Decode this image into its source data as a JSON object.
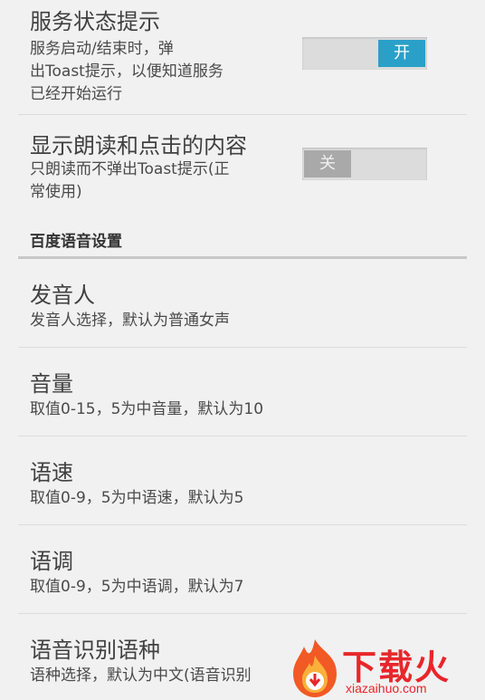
{
  "prefs": {
    "service_status": {
      "title": "服务状态提示",
      "summary_line1": "服务启动/结束时，弹",
      "summary_line2": "出Toast提示，以便知道服务",
      "summary_line3": "已经开始运行",
      "toggle_label": "开",
      "toggle_state": "on"
    },
    "show_content": {
      "title": "显示朗读和点击的内容",
      "summary_line1": "只朗读而不弹出Toast提示(正",
      "summary_line2": "常使用)",
      "toggle_label": "关",
      "toggle_state": "off"
    }
  },
  "category": {
    "title": "百度语音设置"
  },
  "baidu_items": [
    {
      "title": "发音人",
      "summary": "发音人选择，默认为普通女声"
    },
    {
      "title": "音量",
      "summary": "取值0-15，5为中音量，默认为10"
    },
    {
      "title": "语速",
      "summary": "取值0-9，5为中语速，默认为5"
    },
    {
      "title": "语调",
      "summary": "取值0-9，5为中语调，默认为7"
    },
    {
      "title": "语音识别语种",
      "summary": "语种选择，默认为中文(语音识别"
    }
  ],
  "watermark": {
    "brand": "下载火",
    "url": "xiazaihuo.com"
  },
  "colors": {
    "accent_on": "#2aa0c8",
    "watermark": "#e8262b",
    "background": "#f1f1f1"
  }
}
